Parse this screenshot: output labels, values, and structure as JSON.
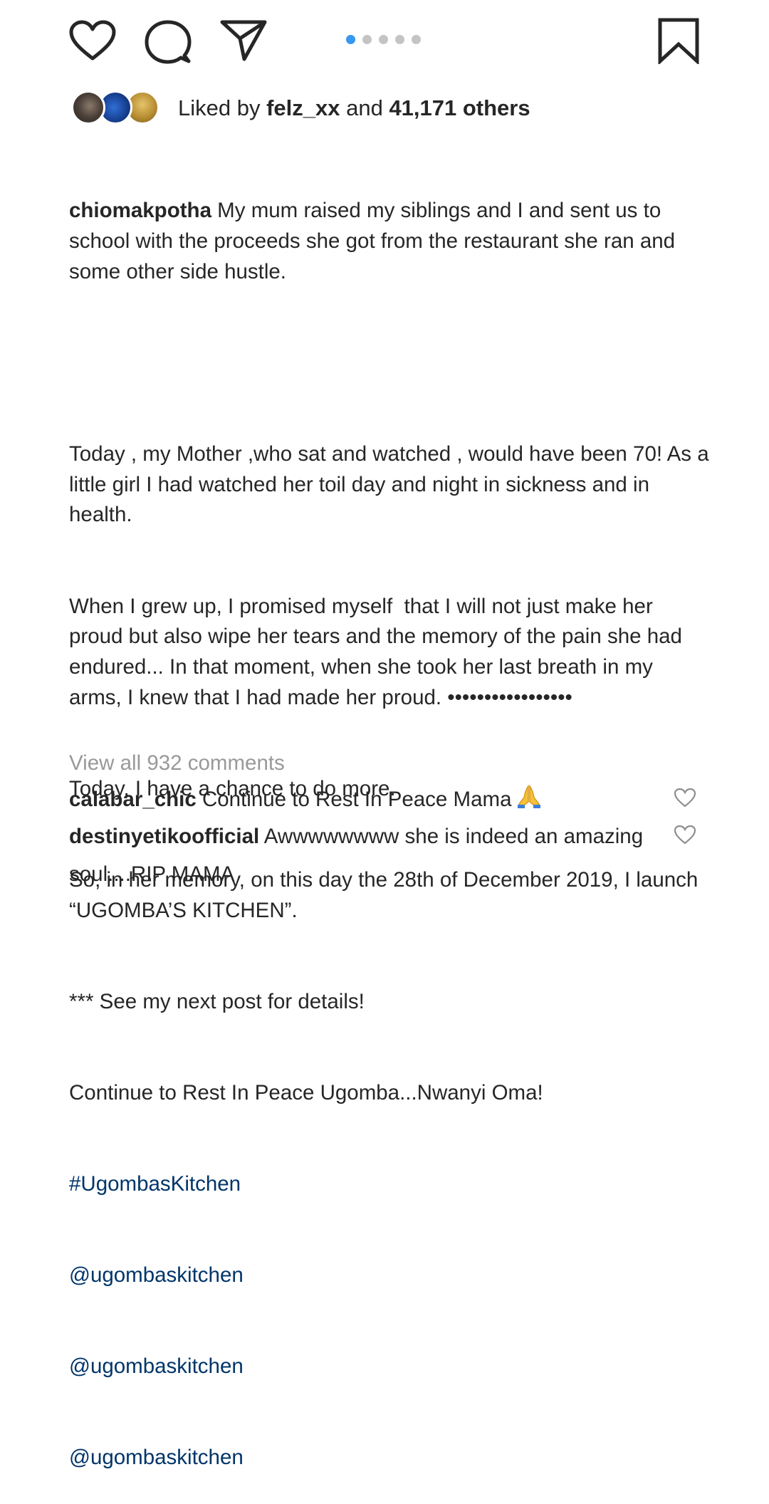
{
  "actions": {
    "like_icon": "heart-outline-icon",
    "comment_icon": "speech-bubble-icon",
    "share_icon": "paper-plane-icon",
    "bookmark_icon": "bookmark-outline-icon",
    "carousel": {
      "total": 5,
      "active_index": 0
    }
  },
  "likes": {
    "prefix": "Liked by ",
    "user": "felz_xx",
    "middle": " and ",
    "count": "41,171 others"
  },
  "caption": {
    "username": "chiomakpotha",
    "first_text": " My mum raised my siblings and I and sent us to school with the proceeds she got from the restaurant she ran and some other side hustle.",
    "lines": [
      "Today , my Mother ,who sat and watched , would have been 70! As a little girl I had watched her toil day and night in sickness and in health.",
      "When I grew up, I promised myself  that I will not just make her proud but also wipe her tears and the memory of the pain she had endured... In that moment, when she took her last breath in my arms, I knew that I had made her proud. •••••••••••••••••",
      "Today, I have a chance to do more.",
      "So, in her memory, on this day the 28th of December 2019, I launch “UGOMBA’S KITCHEN”.",
      "*** See my next post for details!",
      "Continue to Rest In Peace Ugomba...Nwanyi Oma!"
    ],
    "hashtag": "#UgombasKitchen",
    "mentions": [
      "@ugombaskitchen",
      "@ugombaskitchen",
      "@ugombaskitchen"
    ]
  },
  "view_all_comments": "View all 932 comments",
  "comments": [
    {
      "username": "calabar_chic",
      "text": " Continue to Rest In Peace Mama",
      "emoji": "praying-hands-icon"
    },
    {
      "username": "destinyetikoofficial",
      "text": " Awwwwwwww she is indeed an amazing soul....RIP MAMA"
    }
  ],
  "colors": {
    "text": "#262626",
    "link": "#003569",
    "muted": "#999999",
    "dot_active": "#3897f0",
    "dot_inactive": "#c4c4c4"
  }
}
